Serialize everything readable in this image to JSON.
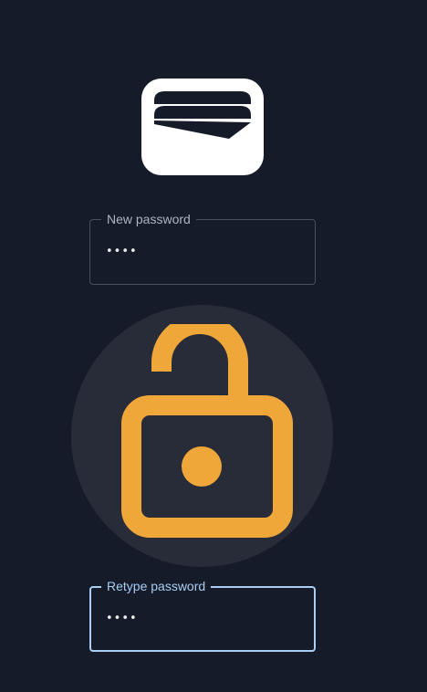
{
  "app": {
    "logo_icon": "wallet-cards-icon"
  },
  "new_password": {
    "label": "New password",
    "value": "••••"
  },
  "lock": {
    "icon": "unlocked-padlock-icon",
    "color": "#f0a73a"
  },
  "retype_password": {
    "label": "Retype password",
    "value": "••••",
    "focused": true,
    "focus_color": "#a9cdf3"
  }
}
